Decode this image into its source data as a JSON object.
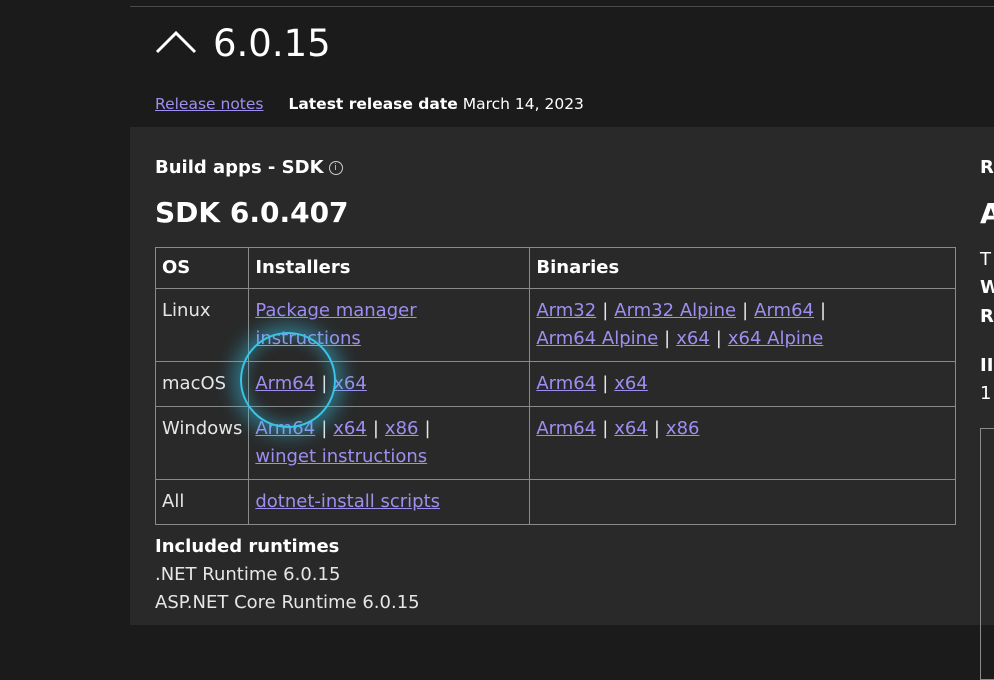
{
  "header": {
    "version": "6.0.15",
    "release_notes_link": "Release notes",
    "latest_release_label": "Latest release date",
    "latest_release_date": "March 14, 2023"
  },
  "sdk": {
    "section_title": "Build apps - SDK",
    "info_icon": "i",
    "title": "SDK 6.0.407"
  },
  "table": {
    "headers": [
      "OS",
      "Installers",
      "Binaries"
    ],
    "rows": [
      {
        "os": "Linux",
        "installers": [
          "Package manager instructions"
        ],
        "binaries": [
          "Arm32",
          "Arm32 Alpine",
          "Arm64",
          "Arm64 Alpine",
          "x64",
          "x64 Alpine"
        ]
      },
      {
        "os": "macOS",
        "installers": [
          "Arm64",
          "x64"
        ],
        "binaries": [
          "Arm64",
          "x64"
        ]
      },
      {
        "os": "Windows",
        "installers": [
          "Arm64",
          "x64",
          "x86",
          "winget instructions"
        ],
        "binaries": [
          "Arm64",
          "x64",
          "x86"
        ]
      },
      {
        "os": "All",
        "installers": [
          "dotnet-install scripts"
        ],
        "binaries": []
      }
    ]
  },
  "included_runtimes": {
    "heading": "Included runtimes",
    "items": [
      ".NET Runtime 6.0.15",
      "ASP.NET Core Runtime 6.0.15"
    ]
  },
  "right_column": {
    "cut_texts": [
      "R",
      "A",
      "T",
      "W",
      "R",
      "II",
      "1"
    ]
  },
  "colors": {
    "link": "#9f8ef0",
    "highlight": "#38c6e8",
    "panel": "#292929",
    "page": "#1b1b1b"
  }
}
